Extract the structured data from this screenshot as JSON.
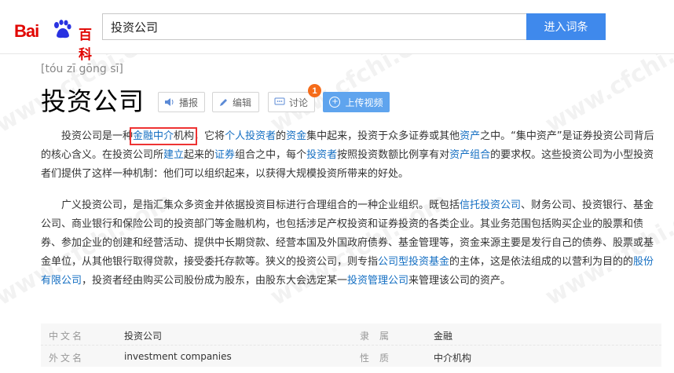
{
  "header": {
    "logo_text_bai": "Bai",
    "logo_text_baike": "百科",
    "search_value": "投资公司",
    "search_button": "进入词条"
  },
  "entry": {
    "pinyin": "[tóu zī gōng sī]",
    "title": "投资公司"
  },
  "actions": {
    "play": "播报",
    "edit": "编辑",
    "discuss": "讨论",
    "discuss_badge": "1",
    "upload_video": "上传视频"
  },
  "paragraphs": {
    "p1": [
      {
        "t": "投资公司是一种"
      },
      {
        "t": "金融中介",
        "link": true,
        "hl": true
      },
      {
        "t": "机构",
        "hl_tail": true
      },
      {
        "t": "，它将"
      },
      {
        "t": "个人投资者",
        "link": true
      },
      {
        "t": "的"
      },
      {
        "t": "资金",
        "link": true
      },
      {
        "t": "集中起来，投资于众多证券或其他"
      },
      {
        "t": "资产",
        "link": true
      },
      {
        "t": "之中。“集中资产”是证券投资公司背后的核心含义。在投资公司所"
      },
      {
        "t": "建立",
        "link": true
      },
      {
        "t": "起来的"
      },
      {
        "t": "证券",
        "link": true
      },
      {
        "t": "组合之中，每个"
      },
      {
        "t": "投资者",
        "link": true
      },
      {
        "t": "按照投资数额比例享有对"
      },
      {
        "t": "资产组合",
        "link": true
      },
      {
        "t": "的要求权。这些投资公司为小型投资者们提供了这样一种机制：他们可以组织起来，以获得大规模投资所带来的好处。"
      }
    ],
    "p2": [
      {
        "t": "广义投资公司，是指汇集众多资金并依据投资目标进行合理组合的一种企业组织。既包括"
      },
      {
        "t": "信托投资公司",
        "link": true
      },
      {
        "t": "、财务公司、投资银行、基金公司、商业银行和保险公司的投资部门等金融机构，也包括涉足产权投资和证券投资的各类企业。其业务范围包括购买企业的股票和债券、参加企业的创建和经营活动、提供中长期贷款、经营本国及外国政府债券、基金管理等，资金来源主要是发行自己的债券、股票或基金单位，从其他银行取得贷款，接受委托存款等。狭义的投资公司，则专指"
      },
      {
        "t": "公司型投资基金",
        "link": true
      },
      {
        "t": "的主体，这是依法组成的以营利为目的的"
      },
      {
        "t": "股份有限公司",
        "link": true
      },
      {
        "t": "，投资者经由购买公司股份成为股东，由股东大会选定某一"
      },
      {
        "t": "投资管理公司",
        "link": true
      },
      {
        "t": "来管理该公司的资产。"
      }
    ]
  },
  "basic_info": [
    {
      "k1": "中文名",
      "v1": "投资公司",
      "k2": "隶属",
      "v2": "金融"
    },
    {
      "k1": "外文名",
      "v1": "investment companies",
      "k2": "性质",
      "v2": "中介机构"
    }
  ],
  "watermark": "www.cfchi.com",
  "colors": {
    "link": "#136ec2",
    "brand_red": "#e10602",
    "search_button": "#3f89ec",
    "upload_button": "#5fa4ee",
    "badge": "#f56c1a",
    "highlight_box": "#e33333"
  }
}
